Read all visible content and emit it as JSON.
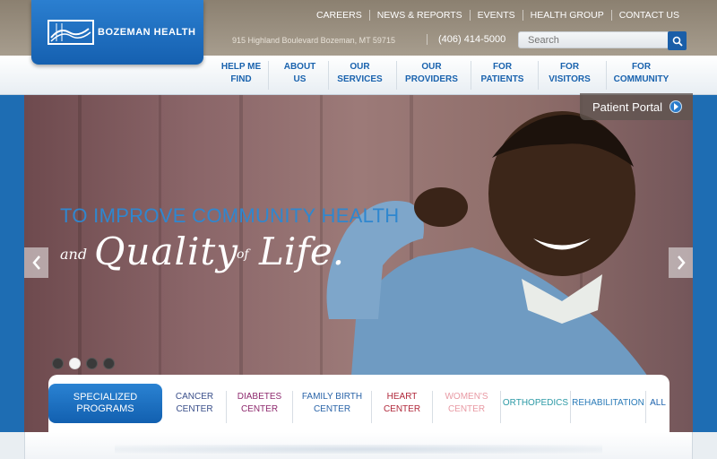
{
  "logo": {
    "text": "BOZEMAN HEALTH"
  },
  "utility_nav": [
    "CAREERS",
    "NEWS & REPORTS",
    "EVENTS",
    "HEALTH GROUP",
    "CONTACT US"
  ],
  "contact": {
    "address": "915 Highland Boulevard Bozeman, MT 59715",
    "phone": "(406) 414-5000"
  },
  "search": {
    "placeholder": "Search"
  },
  "main_nav": [
    {
      "line1": "HELP ME",
      "line2": "FIND"
    },
    {
      "line1": "ABOUT",
      "line2": "US"
    },
    {
      "line1": "OUR",
      "line2": "SERVICES"
    },
    {
      "line1": "OUR",
      "line2": "PROVIDERS"
    },
    {
      "line1": "FOR",
      "line2": "PATIENTS"
    },
    {
      "line1": "FOR",
      "line2": "VISITORS"
    },
    {
      "line1": "FOR",
      "line2": "COMMUNITY"
    }
  ],
  "hero": {
    "headline": "TO IMPROVE COMMUNITY HEALTH",
    "sub_and": "and",
    "sub_quality": "Quality",
    "sub_of": "of",
    "sub_life": "Life."
  },
  "portal": {
    "label": "Patient Portal"
  },
  "slider": {
    "total": 4,
    "active": 2
  },
  "programs": {
    "label_line1": "SPECIALIZED",
    "label_line2": "PROGRAMS",
    "items": [
      {
        "line1": "CANCER",
        "line2": "CENTER",
        "color": "#3a4f8a"
      },
      {
        "line1": "DIABETES",
        "line2": "CENTER",
        "color": "#8e2a6e"
      },
      {
        "line1": "FAMILY BIRTH",
        "line2": "CENTER",
        "color": "#2a64a8"
      },
      {
        "line1": "HEART",
        "line2": "CENTER",
        "color": "#b0283a"
      },
      {
        "line1": "WOMEN'S",
        "line2": "CENTER",
        "color": "#e89aa4"
      },
      {
        "line1": "ORTHOPEDICS",
        "line2": "",
        "color": "#2d9aa6"
      },
      {
        "line1": "REHABILITATION",
        "line2": "",
        "color": "#2a7bb8"
      },
      {
        "line1": "ALL",
        "line2": "",
        "color": "#1e63ad"
      }
    ]
  },
  "colors": {
    "brand_blue": "#1a63ae",
    "topbar": "#9a8f80"
  }
}
